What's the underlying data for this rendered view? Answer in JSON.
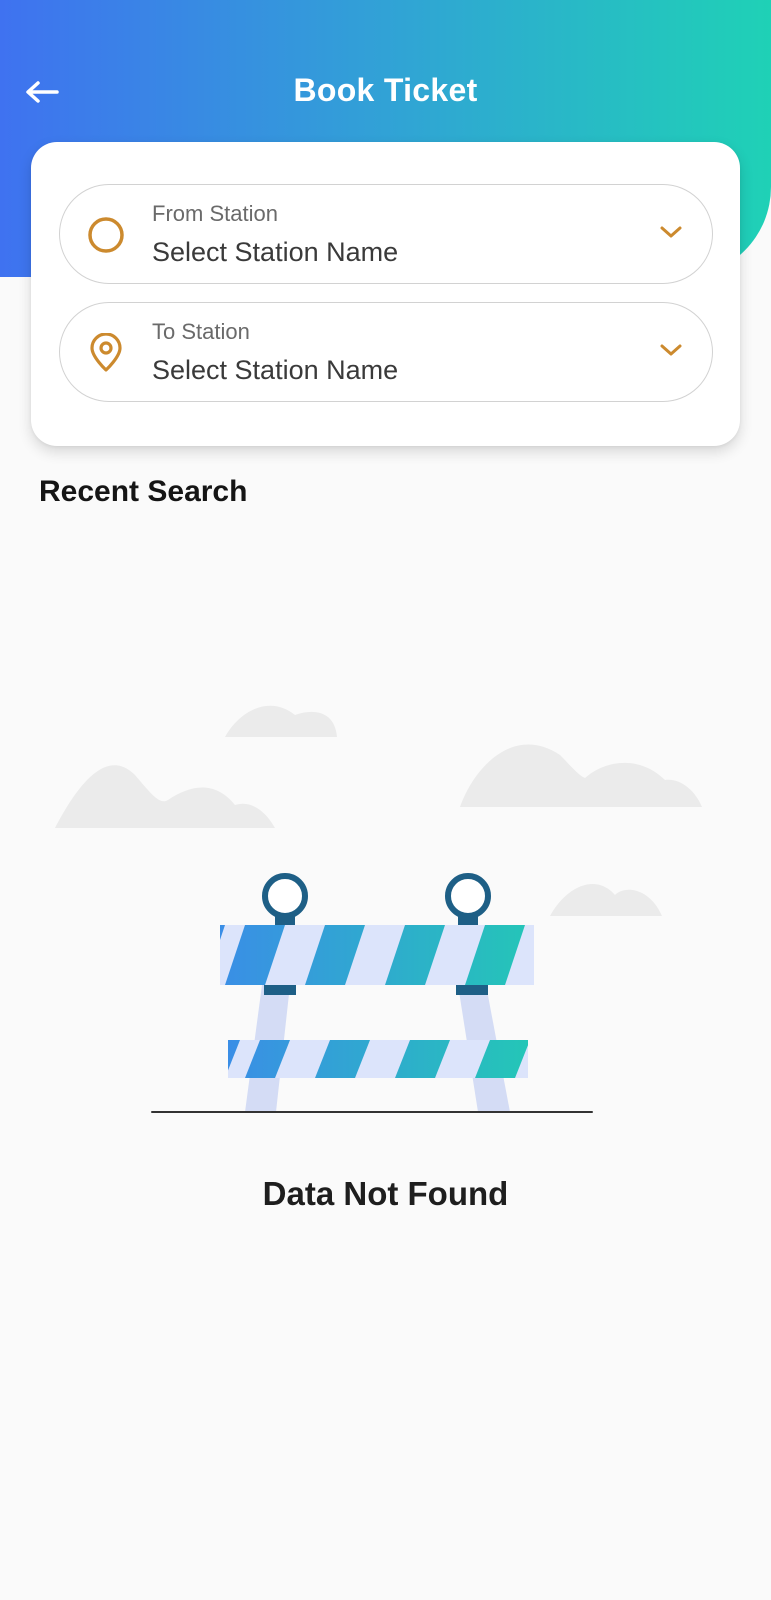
{
  "header": {
    "title": "Book Ticket",
    "back_icon": "arrow-left-icon"
  },
  "form": {
    "from": {
      "label": "From Station",
      "value": "Select Station Name",
      "icon": "circle-icon"
    },
    "to": {
      "label": "To Station",
      "value": "Select Station Name",
      "icon": "map-pin-icon"
    },
    "dropdown_icon": "chevron-down-icon"
  },
  "recent": {
    "title": "Recent Search",
    "empty_message": "Data Not Found"
  },
  "colors": {
    "gradient_start": "#3f72f0",
    "gradient_end": "#1fd1b6",
    "icon_accent": "#cc8a2e"
  }
}
